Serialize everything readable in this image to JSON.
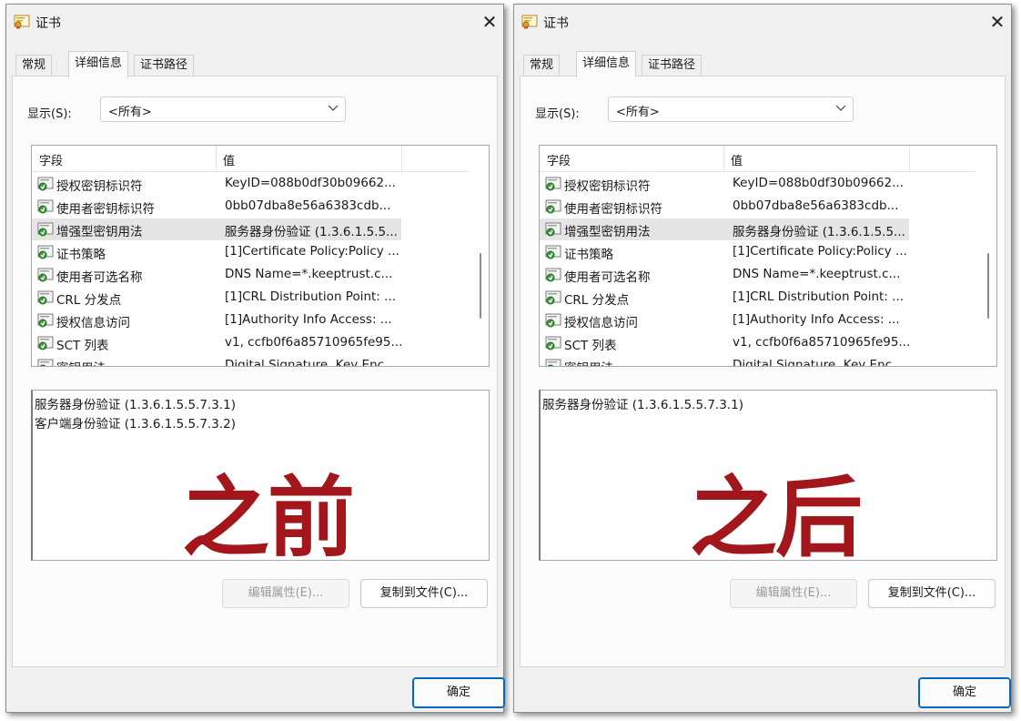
{
  "left": {
    "title": "证书",
    "close_glyph": "✕",
    "tabs": [
      "常规",
      "详细信息",
      "证书路径"
    ],
    "active_tab": "详细信息",
    "show_label": "显示(S):",
    "show_value": "<所有>",
    "columns": {
      "field": "字段",
      "value": "值"
    },
    "rows": [
      {
        "field": "授权密钥标识符",
        "value": "KeyID=088b0df30b09662..."
      },
      {
        "field": "使用者密钥标识符",
        "value": "0bb07dba8e56a6383cdb..."
      },
      {
        "field": "增强型密钥用法",
        "value": "服务器身份验证 (1.3.6.1.5.5...",
        "selected": true
      },
      {
        "field": "证书策略",
        "value": "[1]Certificate Policy:Policy ..."
      },
      {
        "field": "使用者可选名称",
        "value": "DNS Name=*.keeptrust.c..."
      },
      {
        "field": "CRL 分发点",
        "value": "[1]CRL Distribution Point: ..."
      },
      {
        "field": "授权信息访问",
        "value": "[1]Authority Info Access: ..."
      },
      {
        "field": "SCT 列表",
        "value": "v1, ccfb0f6a85710965fe95..."
      },
      {
        "field": "密钥用法",
        "value": "Digital Signature, Key Enc..."
      }
    ],
    "detail_lines": [
      "服务器身份验证 (1.3.6.1.5.5.7.3.1)",
      "客户端身份验证 (1.3.6.1.5.5.7.3.2)"
    ],
    "overlay_text": "之前",
    "edit_button": "编辑属性(E)...",
    "copy_button": "复制到文件(C)...",
    "ok_button": "确定"
  },
  "right": {
    "title": "证书",
    "close_glyph": "✕",
    "tabs": [
      "常规",
      "详细信息",
      "证书路径"
    ],
    "active_tab": "详细信息",
    "show_label": "显示(S):",
    "show_value": "<所有>",
    "columns": {
      "field": "字段",
      "value": "值"
    },
    "rows": [
      {
        "field": "授权密钥标识符",
        "value": "KeyID=088b0df30b09662..."
      },
      {
        "field": "使用者密钥标识符",
        "value": "0bb07dba8e56a6383cdb..."
      },
      {
        "field": "增强型密钥用法",
        "value": "服务器身份验证 (1.3.6.1.5.5...",
        "selected": true
      },
      {
        "field": "证书策略",
        "value": "[1]Certificate Policy:Policy ..."
      },
      {
        "field": "使用者可选名称",
        "value": "DNS Name=*.keeptrust.c..."
      },
      {
        "field": "CRL 分发点",
        "value": "[1]CRL Distribution Point: ..."
      },
      {
        "field": "授权信息访问",
        "value": "[1]Authority Info Access: ..."
      },
      {
        "field": "SCT 列表",
        "value": "v1, ccfb0f6a85710965fe95..."
      },
      {
        "field": "密钥用法",
        "value": "Digital Signature, Key Enc..."
      }
    ],
    "detail_lines": [
      "服务器身份验证 (1.3.6.1.5.5.7.3.1)"
    ],
    "overlay_text": "之后",
    "edit_button": "编辑属性(E)...",
    "copy_button": "复制到文件(C)...",
    "ok_button": "确定"
  },
  "icons": {
    "title": "certificate-icon",
    "row": "certificate-field-icon",
    "dropdown": "chevron-down-icon",
    "close": "close-icon"
  },
  "colors": {
    "overlay": "#a3161b",
    "ok_border": "#0067c0",
    "selected_row": "#e5e5e5"
  }
}
